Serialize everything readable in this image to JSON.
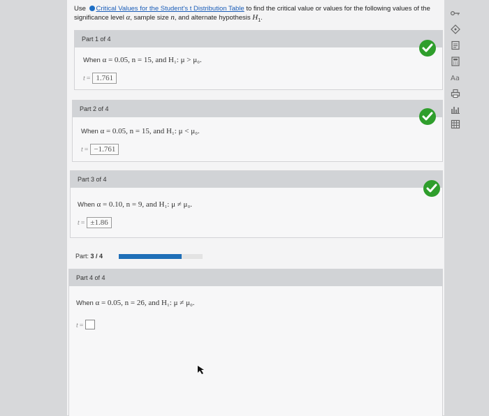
{
  "instructions": {
    "pre": "Use",
    "link": "Critical Values for the Student's t Distribution Table",
    "post_line1": "to find the critical value or values for the following values of the",
    "line2_a": "significance level",
    "alpha": "α",
    "line2_b": ", sample size",
    "n": "n",
    "line2_c": ", and alternate hypothesis",
    "H": "H",
    "H_sub": "1",
    "end": "."
  },
  "parts": [
    {
      "header": "Part 1 of 4",
      "when": "When",
      "condition": "α = 0.05, n = 15, and H₁: μ > μ₀.",
      "t_label": "t",
      "eq": "=",
      "answer": "1.761",
      "status": "correct"
    },
    {
      "header": "Part 2 of 4",
      "when": "When",
      "condition": "α = 0.05, n = 15, and H₁: μ < μ₀.",
      "t_label": "t",
      "eq": "=",
      "answer": "−1.761",
      "status": "correct"
    },
    {
      "header": "Part 3 of 4",
      "when": "When",
      "condition": "α = 0.10, n = 9, and H₁: μ ≠ μ₀.",
      "t_label": "t",
      "eq": "=",
      "answer": "±1.86",
      "status": "correct"
    },
    {
      "header": "Part 4 of 4",
      "when": "When",
      "condition": "α = 0.05, n = 26, and H₁: μ ≠ μ₀.",
      "t_label": "t",
      "eq": "=",
      "answer": "",
      "status": "unanswered"
    }
  ],
  "progress": {
    "label_prefix": "Part:",
    "label_value": "3 / 4",
    "fraction": 0.75
  },
  "toolbar_icons": [
    "key-icon",
    "help-icon",
    "book-icon",
    "calculator-icon",
    "glossary-icon",
    "print-icon",
    "chart-icon",
    "spreadsheet-icon"
  ],
  "colors": {
    "check": "#2f9e2c",
    "link": "#1a5db8",
    "progress": "#1f6fb8"
  }
}
